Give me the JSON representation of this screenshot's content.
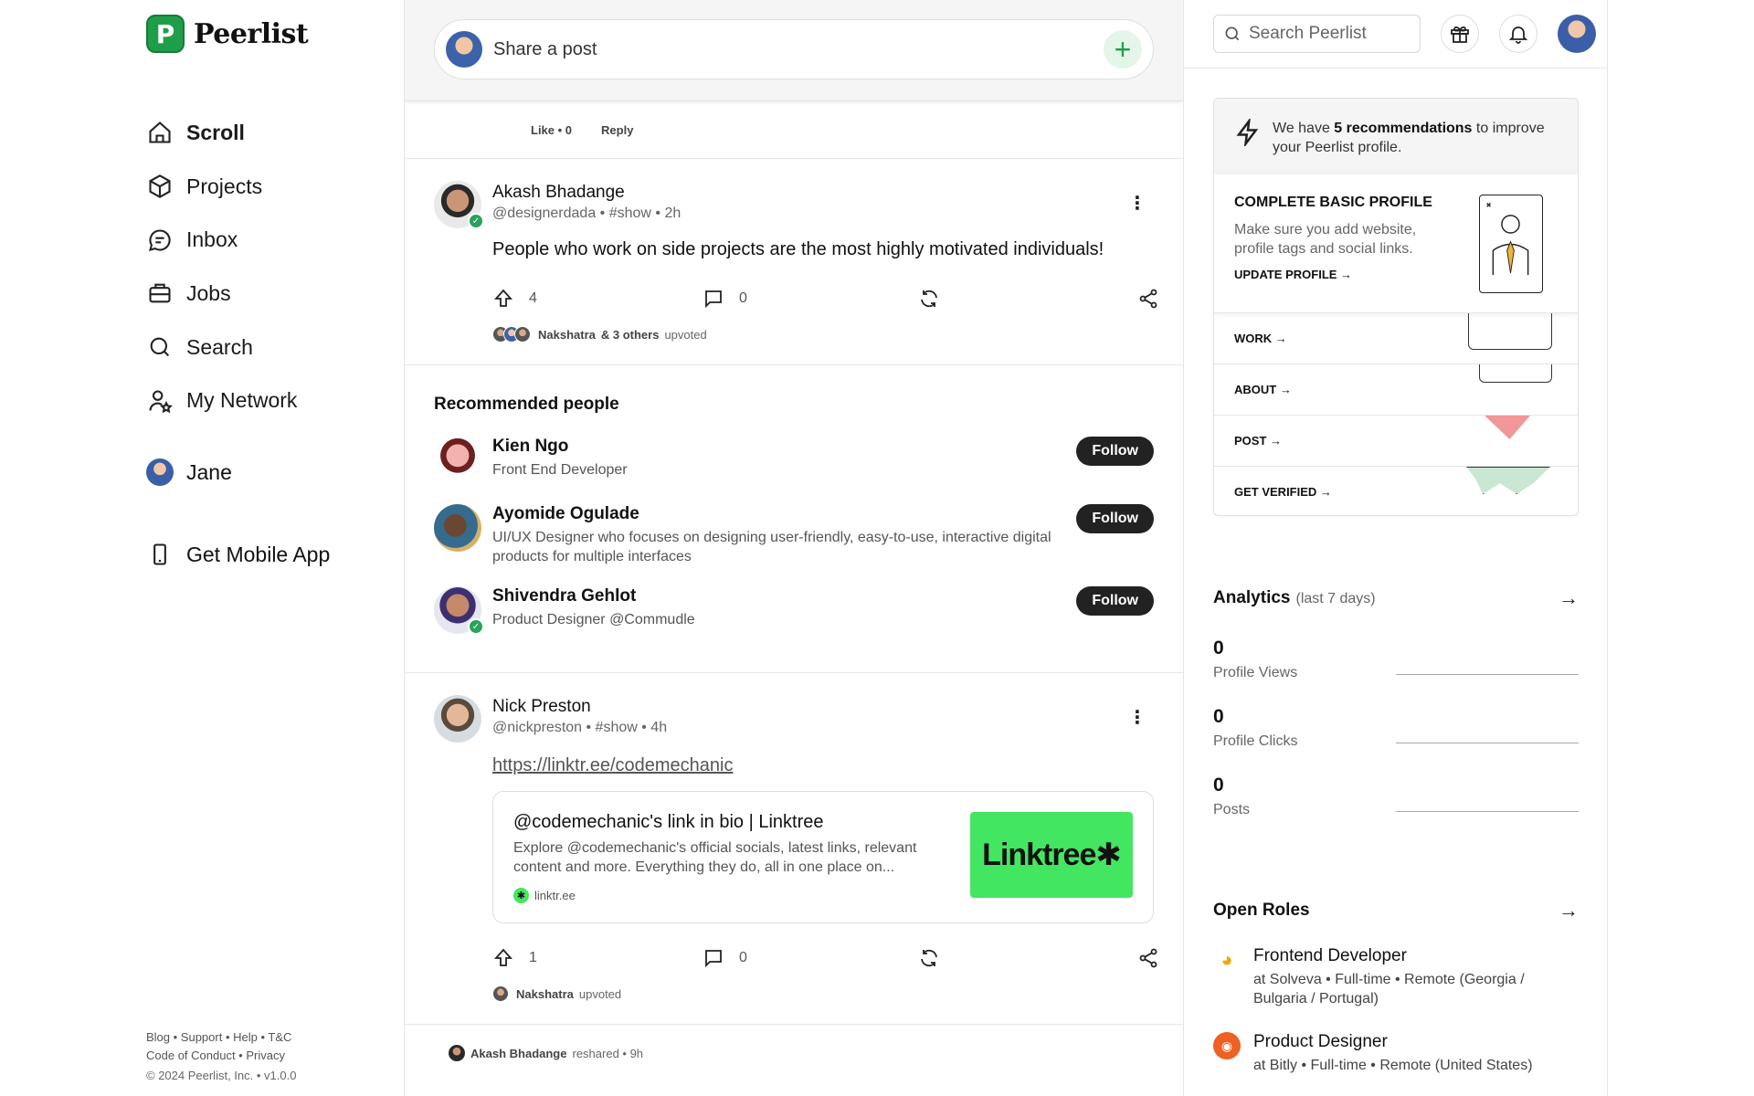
{
  "brand": {
    "name": "Peerlist",
    "mark": "P"
  },
  "nav": {
    "items": [
      {
        "label": "Scroll",
        "icon": "home-icon"
      },
      {
        "label": "Projects",
        "icon": "cube-icon"
      },
      {
        "label": "Inbox",
        "icon": "chat-icon"
      },
      {
        "label": "Jobs",
        "icon": "briefcase-icon"
      },
      {
        "label": "Search",
        "icon": "search-icon"
      },
      {
        "label": "My Network",
        "icon": "network-icon"
      }
    ],
    "user": "Jane",
    "mobile": "Get Mobile App"
  },
  "footer": {
    "line1": "Blog • Support • Help • T&C",
    "line2": "Code of Conduct • Privacy",
    "copyright": "© 2024 Peerlist, Inc. • v1.0.0"
  },
  "composer": {
    "placeholder": "Share a post",
    "add": "+"
  },
  "prev_comment": {
    "like": "Like • 0",
    "reply": "Reply"
  },
  "posts": [
    {
      "author": "Akash Bhadange",
      "meta": "@designerdada • #show • 2h",
      "body": "People who work on side projects are the most highly motivated individuals!",
      "upvotes": "4",
      "comments": "0",
      "upvoters_name": "Nakshatra",
      "upvoters_rest": "& 3 others",
      "upvoters_tail": "upvoted"
    },
    {
      "author": "Nick Preston",
      "meta": "@nickpreston • #show • 4h",
      "link": "https://linktr.ee/codemechanic",
      "card_title": "@codemechanic's link in bio | Linktree",
      "card_desc": "Explore @codemechanic's official socials, latest links, relevant content and more. Everything they do, all in one place on...",
      "card_domain": "linktr.ee",
      "card_thumb": "Linktree✱",
      "upvotes": "1",
      "comments": "0",
      "upvoters_name": "Nakshatra",
      "upvoters_tail": "upvoted"
    }
  ],
  "recommended": {
    "title": "Recommended people",
    "follow": "Follow",
    "people": [
      {
        "name": "Kien Ngo",
        "desc": "Front End Developer"
      },
      {
        "name": "Ayomide Ogulade",
        "desc": "UI/UX Designer who focuses on designing user-friendly, easy-to-use, interactive digital products for multiple interfaces"
      },
      {
        "name": "Shivendra Gehlot",
        "desc": "Product Designer @Commudle"
      }
    ]
  },
  "reshare": {
    "name": "Akash Bhadange",
    "text": "reshared • 9h"
  },
  "topbar": {
    "search_placeholder": "Search Peerlist"
  },
  "recommendations": {
    "pre": "We have ",
    "count": "5 recommendations",
    "post": " to improve your Peerlist profile.",
    "main_title": "COMPLETE BASIC PROFILE",
    "main_desc": "Make sure you add website, profile tags and social links.",
    "main_link": "UPDATE PROFILE →",
    "steps": [
      "WORK →",
      "ABOUT →",
      "POST →",
      "GET VERIFIED →"
    ]
  },
  "analytics": {
    "title": "Analytics",
    "range": "(last 7 days)",
    "metrics": [
      {
        "value": "0",
        "label": "Profile Views"
      },
      {
        "value": "0",
        "label": "Profile Clicks"
      },
      {
        "value": "0",
        "label": "Posts"
      }
    ]
  },
  "open_roles": {
    "title": "Open Roles",
    "roles": [
      {
        "title": "Frontend Developer",
        "sub": "at Solveva • Full-time • Remote (Georgia / Bulgaria / Portugal)"
      },
      {
        "title": "Product Designer",
        "sub": "at Bitly • Full-time • Remote (United States)"
      }
    ]
  },
  "colors": {
    "brand_green": "#1f9e4a",
    "linktree_green": "#43e660",
    "button_dark": "#222222"
  }
}
